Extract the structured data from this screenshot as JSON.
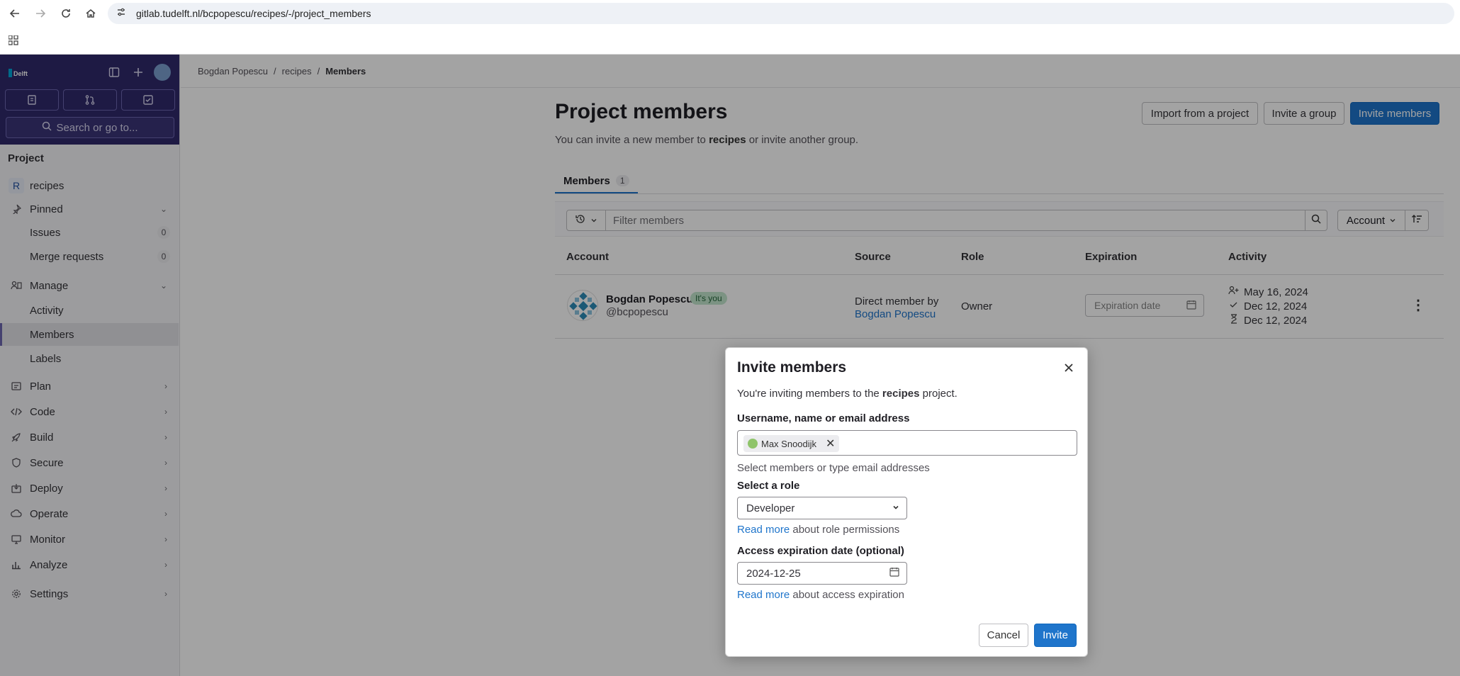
{
  "browser": {
    "url": "gitlab.tudelft.nl/bcpopescu/recipes/-/project_members"
  },
  "sidebar": {
    "logo_text": "TU Delft",
    "search_placeholder": "Search or go to...",
    "section_label": "Project",
    "project_badge": "R",
    "project_name": "recipes",
    "items": [
      {
        "label": "Pinned"
      },
      {
        "label": "Issues",
        "count": "0"
      },
      {
        "label": "Merge requests",
        "count": "0"
      },
      {
        "label": "Manage"
      },
      {
        "label": "Activity"
      },
      {
        "label": "Members"
      },
      {
        "label": "Labels"
      },
      {
        "label": "Plan"
      },
      {
        "label": "Code"
      },
      {
        "label": "Build"
      },
      {
        "label": "Secure"
      },
      {
        "label": "Deploy"
      },
      {
        "label": "Operate"
      },
      {
        "label": "Monitor"
      },
      {
        "label": "Analyze"
      },
      {
        "label": "Settings"
      }
    ]
  },
  "breadcrumb": [
    "Bogdan Popescu",
    "recipes",
    "Members"
  ],
  "header": {
    "title": "Project members",
    "subtitle_pre": "You can invite a new member to ",
    "subtitle_project": "recipes",
    "subtitle_post": " or invite another group.",
    "import_btn": "Import from a project",
    "invite_group_btn": "Invite a group",
    "invite_members_btn": "Invite members"
  },
  "tabs": [
    {
      "label": "Members",
      "count": "1"
    }
  ],
  "filter": {
    "placeholder": "Filter members",
    "sort_label": "Account"
  },
  "table": {
    "columns": [
      "Account",
      "Source",
      "Role",
      "Expiration",
      "Activity"
    ],
    "rows": [
      {
        "name": "Bogdan Popescu",
        "badge": "It's you",
        "username": "@bcpopescu",
        "source_pre": "Direct member by",
        "source_link": "Bogdan Popescu",
        "role": "Owner",
        "expiration_placeholder": "Expiration date",
        "activity": [
          "May 16, 2024",
          "Dec 12, 2024",
          "Dec 12, 2024"
        ]
      }
    ]
  },
  "modal": {
    "title": "Invite members",
    "intro_pre": "You're inviting members to the ",
    "intro_project": "recipes",
    "intro_post": " project.",
    "user_label": "Username, name or email address",
    "token": "Max Snoodijk",
    "user_help": "Select members or type email addresses",
    "role_label": "Select a role",
    "role_value": "Developer",
    "role_help_link": "Read more",
    "role_help_text": " about role permissions",
    "date_label": "Access expiration date (optional)",
    "date_value": "2024-12-25",
    "date_help_link": "Read more",
    "date_help_text": " about access expiration",
    "cancel_btn": "Cancel",
    "invite_btn": "Invite"
  },
  "colors": {
    "sidebar_top": "#2f2a6b",
    "primary": "#1f75cb",
    "badge_green": "#c3e6cd"
  }
}
